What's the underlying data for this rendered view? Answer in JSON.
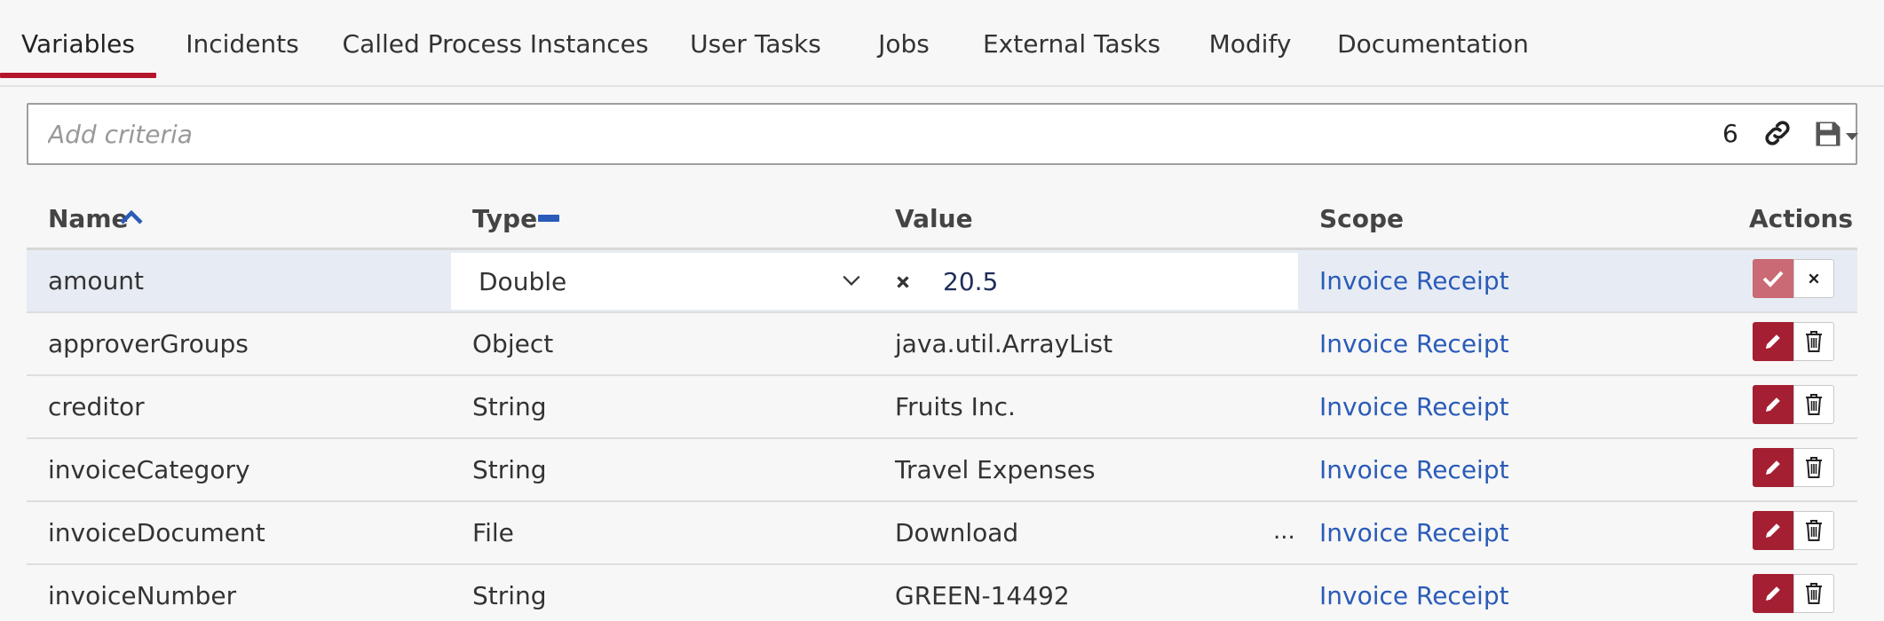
{
  "tabs": [
    {
      "label": "Variables",
      "active": true
    },
    {
      "label": "Incidents"
    },
    {
      "label": "Called Process Instances"
    },
    {
      "label": "User Tasks"
    },
    {
      "label": "Jobs"
    },
    {
      "label": "External Tasks"
    },
    {
      "label": "Modify"
    },
    {
      "label": "Documentation"
    }
  ],
  "search": {
    "placeholder": "Add criteria",
    "count": "6"
  },
  "table": {
    "headers": {
      "name": "Name",
      "type": "Type",
      "value": "Value",
      "scope": "Scope",
      "actions": "Actions"
    },
    "editing_row": {
      "name": "amount",
      "type": "Double",
      "value": "20.5",
      "scope": "Invoice Receipt"
    },
    "rows": [
      {
        "name": "approverGroups",
        "type": "Object",
        "value": "java.util.ArrayList",
        "scope": "Invoice Receipt"
      },
      {
        "name": "creditor",
        "type": "String",
        "value": "Fruits Inc.",
        "scope": "Invoice Receipt"
      },
      {
        "name": "invoiceCategory",
        "type": "String",
        "value": "Travel Expenses",
        "scope": "Invoice Receipt"
      },
      {
        "name": "invoiceDocument",
        "type": "File",
        "value": "Download",
        "ellipsis": "...",
        "scope": "Invoice Receipt"
      },
      {
        "name": "invoiceNumber",
        "type": "String",
        "value": "GREEN-14492",
        "scope": "Invoice Receipt"
      }
    ]
  },
  "colors": {
    "accent_red": "#a51f32",
    "link_blue": "#2a5bb8",
    "tab_underline": "#b5152b"
  },
  "icons": {
    "sort_name": "sort-ascending-icon",
    "sort_type": "sort-none-icon",
    "link": "link-icon",
    "save": "floppy-disk-icon",
    "edit": "pencil-icon",
    "delete": "trash-icon",
    "confirm": "checkmark-icon",
    "cancel": "close-icon"
  }
}
